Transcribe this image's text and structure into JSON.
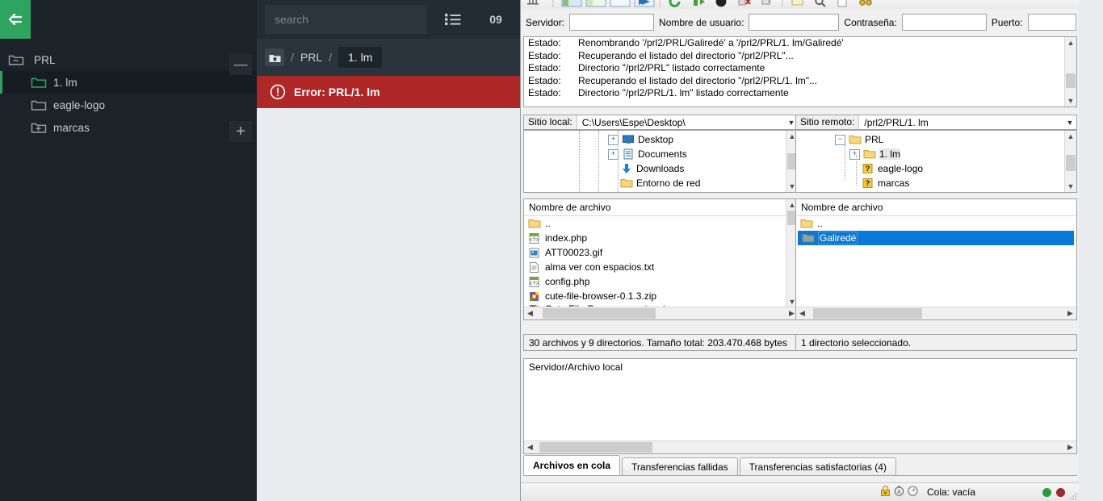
{
  "app": {
    "sidebar": {
      "back_icon": "back-arrow-icon",
      "collapse_label": "—",
      "add_label": "+",
      "items": [
        {
          "label": "PRL",
          "icon": "folder-minus-icon",
          "level": 0,
          "selected": false
        },
        {
          "label": "1. lm",
          "icon": "folder-open-icon",
          "level": 1,
          "selected": true
        },
        {
          "label": "eagle-logo",
          "icon": "folder-icon",
          "level": 1,
          "selected": false
        },
        {
          "label": "marcas",
          "icon": "folder-plus-icon",
          "level": 1,
          "selected": false
        }
      ]
    },
    "topbar": {
      "search_placeholder": "search",
      "search_value": "",
      "list_view_icon": "list-view-icon",
      "counter_label": "09",
      "counter_icon": "stepper-icon",
      "expand_icon": "expand-arrows-icon"
    },
    "breadcrumb": {
      "home_icon": "home-folder-icon",
      "separator": "/",
      "items": [
        {
          "label": "PRL",
          "active": false
        },
        {
          "label": "1. lm",
          "active": true
        }
      ]
    },
    "error": {
      "icon": "error-exclamation-icon",
      "text": "Error: PRL/1. lm",
      "color": "#b02727"
    }
  },
  "filezilla": {
    "quickconnect": {
      "server_label": "Servidor:",
      "server_value": "",
      "username_label": "Nombre de usuario:",
      "username_value": "",
      "password_label": "Contraseña:",
      "password_value": "",
      "port_label": "Puerto:",
      "port_value": ""
    },
    "log": [
      {
        "kind": "Estado:",
        "message": "Renombrando '/prl2/PRL/Galiredé' a '/prl2/PRL/1. lm/Galiredé'"
      },
      {
        "kind": "Estado:",
        "message": "Recuperando el listado del directorio \"/prl2/PRL\"..."
      },
      {
        "kind": "Estado:",
        "message": "Directorio \"/prl2/PRL\" listado correctamente"
      },
      {
        "kind": "Estado:",
        "message": "Recuperando el listado del directorio \"/prl2/PRL/1. lm\"..."
      },
      {
        "kind": "Estado:",
        "message": "Directorio \"/prl2/PRL/1. lm\" listado correctamente"
      }
    ],
    "local": {
      "site_label": "Sitio local:",
      "site_value": "C:\\Users\\Espe\\Desktop\\",
      "tree": [
        {
          "label": "Desktop",
          "icon": "monitor-icon",
          "expander": "+",
          "indent": 3
        },
        {
          "label": "Documents",
          "icon": "documents-icon",
          "expander": "+",
          "indent": 3
        },
        {
          "label": "Downloads",
          "icon": "download-arrow-icon",
          "expander": "",
          "indent": 3
        },
        {
          "label": "Entorno de red",
          "icon": "folder-icon",
          "expander": "",
          "indent": 3
        }
      ],
      "column_header": "Nombre de archivo",
      "files": [
        {
          "name": "..",
          "icon": "folder-icon"
        },
        {
          "name": "index.php",
          "icon": "php-file-icon"
        },
        {
          "name": "ATT00023.gif",
          "icon": "image-file-icon"
        },
        {
          "name": "alma ver con espacios.txt",
          "icon": "text-file-icon"
        },
        {
          "name": "config.php",
          "icon": "php-file-icon"
        },
        {
          "name": "cute-file-browser-0.1.3.zip",
          "icon": "zip-file-icon"
        },
        {
          "name": "Cute-File-Browser-master.zip",
          "icon": "zip-file-icon"
        }
      ],
      "status": "30 archivos y 9 directorios. Tamaño total: 203.470.468 bytes"
    },
    "remote": {
      "site_label": "Sitio remoto:",
      "site_value": "/prl2/PRL/1. lm",
      "tree": [
        {
          "label": "PRL",
          "icon": "folder-icon",
          "expander": "-",
          "indent": 1,
          "selected": false
        },
        {
          "label": "1. lm",
          "icon": "folder-icon",
          "expander": "+",
          "indent": 2,
          "selected": true
        },
        {
          "label": "eagle-logo",
          "icon": "unknown-folder-icon",
          "expander": "",
          "indent": 2,
          "selected": false
        },
        {
          "label": "marcas",
          "icon": "unknown-folder-icon",
          "expander": "",
          "indent": 2,
          "selected": false
        }
      ],
      "column_header": "Nombre de archivo",
      "files": [
        {
          "name": "..",
          "icon": "folder-icon",
          "selected": false
        },
        {
          "name": "Galiredé",
          "icon": "folder-gray-icon",
          "selected": true
        }
      ],
      "status": "1 directorio seleccionado."
    },
    "queue": {
      "column_header": "Servidor/Archivo local",
      "rows": []
    },
    "tabs": [
      {
        "label": "Archivos en cola",
        "active": true
      },
      {
        "label": "Transferencias fallidas",
        "active": false
      },
      {
        "label": "Transferencias satisfactorias (4)",
        "active": false
      }
    ],
    "statusbar": {
      "lock_icon": "padlock-icon",
      "speed_icon": "speed-limit-icon",
      "clock_icon": "timer-icon",
      "queue_text": "Cola: vacía",
      "light_green": "#2a9a3a",
      "light_red": "#9e2b2b"
    }
  }
}
